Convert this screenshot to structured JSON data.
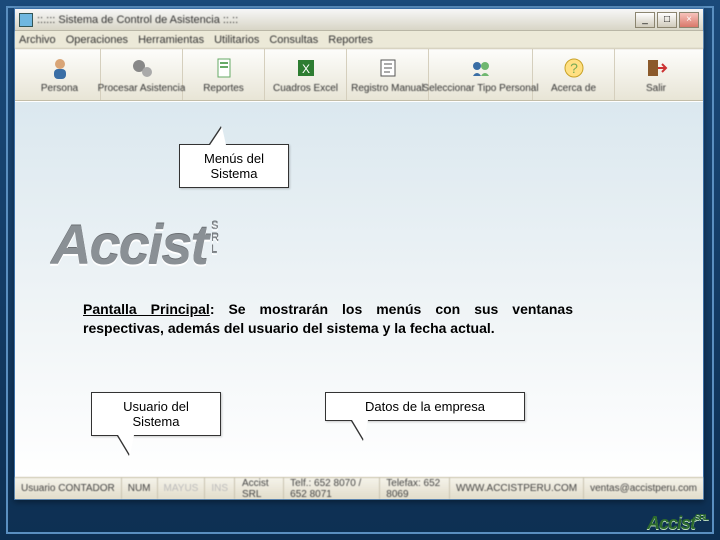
{
  "window": {
    "title": "::.::: Sistema de Control de Asistencia ::.::"
  },
  "menubar": [
    "Archivo",
    "Operaciones",
    "Herramientas",
    "Utilitarios",
    "Consultas",
    "Reportes"
  ],
  "toolbar": [
    {
      "label": "Persona",
      "icon": "person"
    },
    {
      "label": "Procesar Asistencia",
      "icon": "gears"
    },
    {
      "label": "Reportes",
      "icon": "report"
    },
    {
      "label": "Cuadros Excel",
      "icon": "excel"
    },
    {
      "label": "Registro Manual",
      "icon": "manual"
    },
    {
      "label": "Seleccionar Tipo Personal",
      "icon": "select-personnel"
    },
    {
      "label": "Acerca de",
      "icon": "about"
    },
    {
      "label": "Salir",
      "icon": "exit"
    }
  ],
  "brand": {
    "name": "Accist",
    "suffix": [
      "S",
      "R",
      "L"
    ]
  },
  "callouts": {
    "menus": "Menús del Sistema",
    "user": "Usuario del Sistema",
    "company": "Datos de la empresa"
  },
  "description": {
    "title": "Pantalla Principal",
    "body": ": Se mostrarán los menús con sus ventanas respectivas, además del usuario del sistema y la fecha actual."
  },
  "statusbar": {
    "user_label": "Usuario",
    "user_value": "CONTADOR",
    "num": "NUM",
    "mayus": "MAYUS",
    "ins": "INS",
    "company": "Accist SRL",
    "phone": "Telf.: 652 8070 / 652 8071",
    "fax": "Telefax: 652 8069",
    "web": "WWW.ACCISTPERU.COM",
    "email": "ventas@accistperu.com"
  },
  "slide_logo": {
    "name": "Accist",
    "suffix": "SRL"
  }
}
